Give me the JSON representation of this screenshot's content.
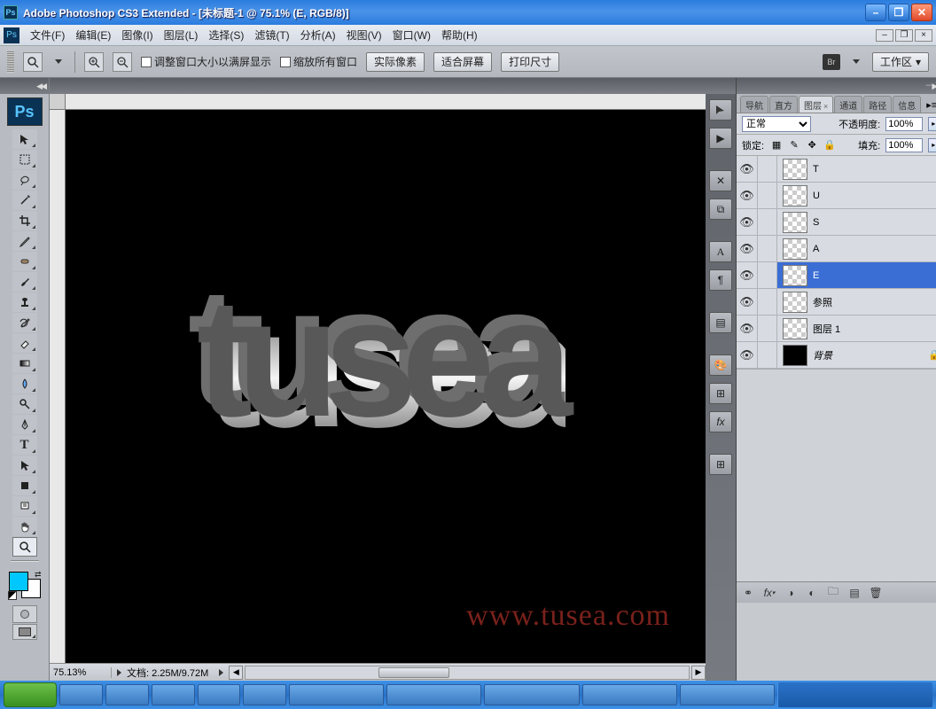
{
  "title": "Adobe Photoshop CS3 Extended - [未标题-1 @ 75.1% (E, RGB/8)]",
  "menu": [
    "文件(F)",
    "编辑(E)",
    "图像(I)",
    "图层(L)",
    "选择(S)",
    "滤镜(T)",
    "分析(A)",
    "视图(V)",
    "窗口(W)",
    "帮助(H)"
  ],
  "options": {
    "checkbox1": "调整窗口大小以满屏显示",
    "checkbox2": "缩放所有窗口",
    "btn1": "实际像素",
    "btn2": "适合屏幕",
    "btn3": "打印尺寸",
    "workspace": "工作区"
  },
  "status": {
    "zoom": "75.13%",
    "docinfo": "文档: 2.25M/9.72M"
  },
  "watermark": "www.tusea.com",
  "artwork_text": "tusea",
  "panel": {
    "tabs": [
      "导航",
      "直方",
      "图层",
      "通道",
      "路径",
      "信息"
    ],
    "active_tab_index": 2,
    "closable_tab_index": 2,
    "blend_label": "正常",
    "opacity_label": "不透明度:",
    "opacity_value": "100%",
    "lock_label": "锁定:",
    "fill_label": "填充:",
    "fill_value": "100%",
    "layers": [
      {
        "name": "T",
        "visible": true
      },
      {
        "name": "U",
        "visible": true
      },
      {
        "name": "S",
        "visible": true
      },
      {
        "name": "A",
        "visible": true
      },
      {
        "name": "E",
        "visible": true,
        "selected": true
      },
      {
        "name": "参照",
        "visible": true
      },
      {
        "name": "图层 1",
        "visible": true
      },
      {
        "name": "背景",
        "visible": true,
        "italic": true,
        "locked": true,
        "black": true
      }
    ]
  },
  "bridge_label": "Br",
  "colors": {
    "fg": "#00c8ff",
    "bg": "#ffffff"
  }
}
